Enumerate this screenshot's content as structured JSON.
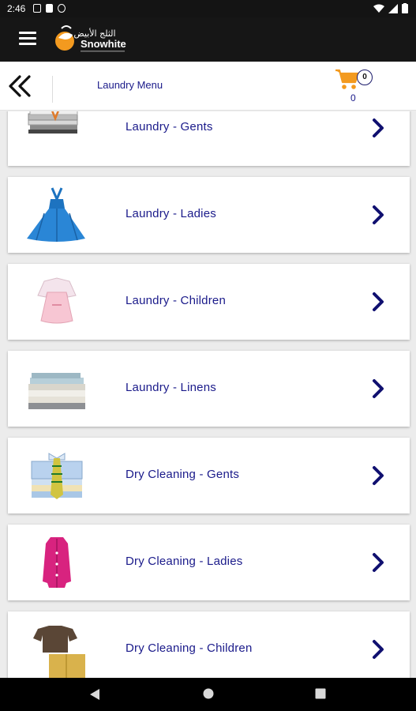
{
  "status_bar": {
    "time": "2:46"
  },
  "app_bar": {
    "logo_text": "Snowhite",
    "logo_arabic": "الثلج الأبيض"
  },
  "sub_header": {
    "title": "Laundry Menu",
    "cart_badge": "0",
    "cart_count": "0"
  },
  "menu": {
    "items": [
      {
        "label": "Laundry - Gents",
        "icon": "folded-shirts-image"
      },
      {
        "label": "Laundry - Ladies",
        "icon": "blue-dress-image"
      },
      {
        "label": "Laundry - Children",
        "icon": "pink-baby-dress-image"
      },
      {
        "label": "Laundry - Linens",
        "icon": "folded-linens-image"
      },
      {
        "label": "Dry Cleaning - Gents",
        "icon": "shirts-and-tie-image"
      },
      {
        "label": "Dry Cleaning - Ladies",
        "icon": "pink-blouse-image"
      },
      {
        "label": "Dry Cleaning - Children",
        "icon": "kids-clothes-image"
      }
    ]
  },
  "colors": {
    "label": "#1a1a8a",
    "chevron": "#101070",
    "cart": "#f39a1f",
    "app_bar": "#161616"
  }
}
